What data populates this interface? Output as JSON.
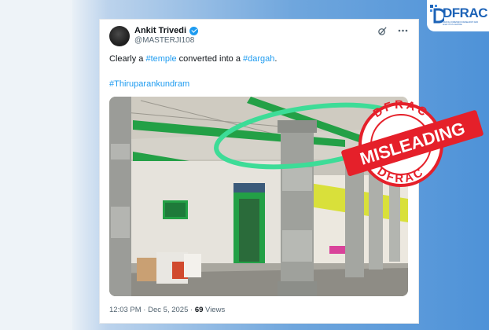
{
  "tweet": {
    "author_name": "Ankit Trivedi",
    "handle": "@MASTERJI108",
    "text_prefix": "Clearly a ",
    "text_tag1": "#temple",
    "text_middle": " converted into a ",
    "text_tag2": "#dargah",
    "text_suffix": ".",
    "hashtag": "#Thiruparankundram",
    "time": "12:03 PM",
    "separator": " · ",
    "date": "Dec 5, 2025",
    "views_count": "69",
    "views_label": " Views"
  },
  "stamp": {
    "label": "MISLEADING",
    "ring_text_top": "DFRAC",
    "ring_text_bottom": "DFRAC"
  },
  "logo": {
    "text": "DFRAC",
    "tagline": "DIGITAL FORENSICS RESEARCH AND ANALYTICS CENTRE"
  },
  "colors": {
    "link": "#1d9bf0",
    "stamp_red": "#e5202a",
    "highlight_circle": "#3ddc97",
    "brand_blue": "#1d63b7"
  },
  "icons": [
    "verified-icon",
    "grok-icon",
    "more-icon",
    "dfrac-logo-icon"
  ]
}
